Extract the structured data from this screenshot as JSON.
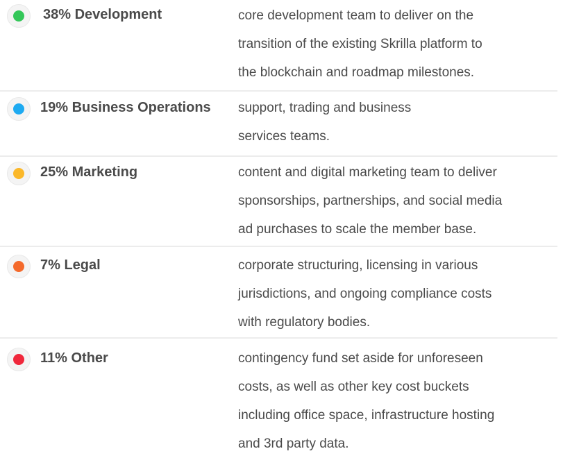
{
  "items": [
    {
      "percent": "38%",
      "name": "Development",
      "color": "#34c759",
      "lines": [
        "core development team to deliver on the",
        "transition of the existing Skrilla platform to",
        "the blockchain and roadmap milestones."
      ]
    },
    {
      "percent": "19%",
      "name": "Business Operations",
      "color": "#1eaaf1",
      "lines": [
        "support, trading and business",
        "services teams."
      ]
    },
    {
      "percent": "25%",
      "name": "Marketing",
      "color": "#fbb82a",
      "lines": [
        "content and digital marketing team to deliver",
        "sponsorships, partnerships, and social media",
        "ad purchases to scale the member base."
      ]
    },
    {
      "percent": "7%",
      "name": "Legal",
      "color": "#f46a2c",
      "lines": [
        "corporate structuring, licensing in various",
        "jurisdictions, and ongoing compliance costs",
        "with regulatory bodies."
      ]
    },
    {
      "percent": "11%",
      "name": "Other",
      "color": "#f0283c",
      "lines": [
        "contingency fund set aside for unforeseen",
        "costs, as well as other key cost buckets",
        "including office space, infrastructure hosting",
        "and 3rd party data."
      ]
    }
  ]
}
